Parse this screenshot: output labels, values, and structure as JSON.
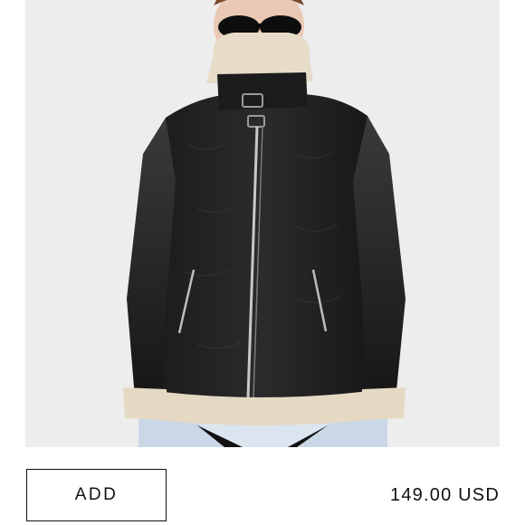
{
  "product": {
    "image_alt_icon": "product-photo",
    "add_label": "ADD",
    "price": "149.00 USD"
  },
  "colors": {
    "background": "#ffffff",
    "photo_background": "#ededee",
    "text": "#111111",
    "button_border": "#111111"
  }
}
